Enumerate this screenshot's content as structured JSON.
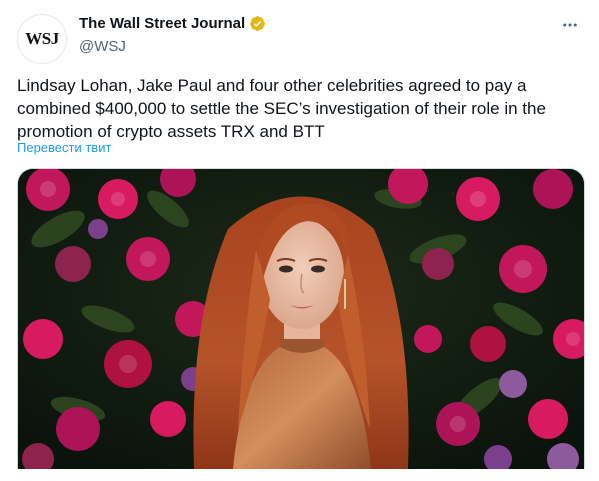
{
  "account": {
    "avatar_text": "WSJ",
    "display_name": "The Wall Street Journal",
    "handle": "@WSJ",
    "verified_badge_color": "#e2b719"
  },
  "tweet": {
    "text": "Lindsay Lohan, Jake Paul and four other celebrities agreed to pay a combined $400,000 to settle the SEC’s investigation of their role in the promotion of crypto assets TRX and BTT",
    "translate_label": "Перевести твит"
  },
  "colors": {
    "link": "#1d9bf0",
    "secondary_text": "#536471",
    "primary_text": "#0f1419"
  },
  "icons": {
    "verified": "gold-check-badge-icon",
    "more": "more-horizontal-icon"
  }
}
